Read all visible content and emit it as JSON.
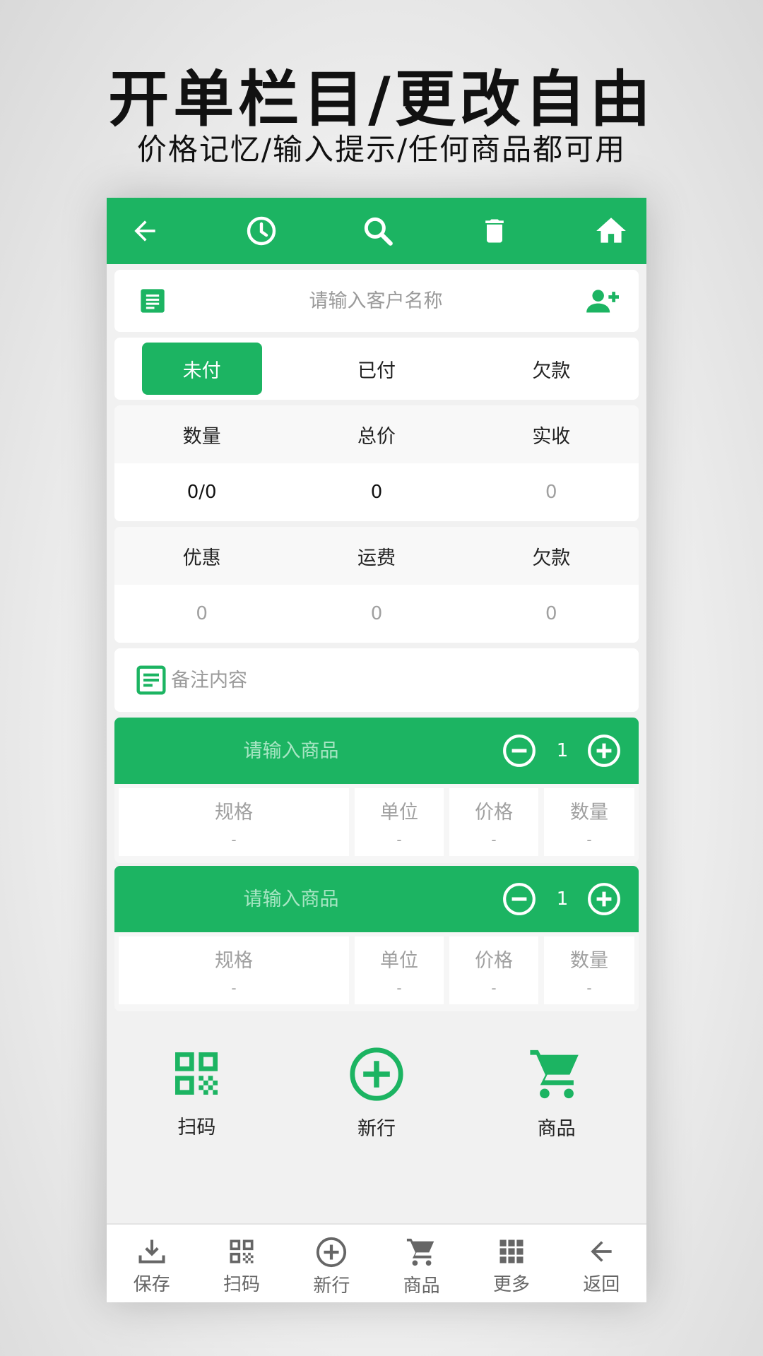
{
  "promo": {
    "title": "开单栏目/更改自由",
    "subtitle": "价格记忆/输入提示/任何商品都可用"
  },
  "topbar": {
    "icons": [
      "back-icon",
      "history-icon",
      "search-icon",
      "trash-icon",
      "home-icon"
    ]
  },
  "customer": {
    "placeholder": "请输入客户名称",
    "icons": [
      "document-icon",
      "add-user-icon"
    ]
  },
  "status_tabs": [
    {
      "label": "未付",
      "active": true
    },
    {
      "label": "已付",
      "active": false
    },
    {
      "label": "欠款",
      "active": false
    }
  ],
  "summary1": {
    "headers": [
      "数量",
      "总价",
      "实收"
    ],
    "values": [
      "0/0",
      "0",
      "0"
    ]
  },
  "summary2": {
    "headers": [
      "优惠",
      "运费",
      "欠款"
    ],
    "values": [
      "0",
      "0",
      "0"
    ]
  },
  "remark": {
    "placeholder": "备注内容"
  },
  "products": [
    {
      "placeholder": "请输入商品",
      "quantity": "1",
      "columns": [
        {
          "label": "规格",
          "value": "-"
        },
        {
          "label": "单位",
          "value": "-"
        },
        {
          "label": "价格",
          "value": "-"
        },
        {
          "label": "数量",
          "value": "-"
        }
      ]
    },
    {
      "placeholder": "请输入商品",
      "quantity": "1",
      "columns": [
        {
          "label": "规格",
          "value": "-"
        },
        {
          "label": "单位",
          "value": "-"
        },
        {
          "label": "价格",
          "value": "-"
        },
        {
          "label": "数量",
          "value": "-"
        }
      ]
    }
  ],
  "quick_actions": [
    {
      "label": "扫码",
      "icon": "qr-code-icon"
    },
    {
      "label": "新行",
      "icon": "add-circle-icon"
    },
    {
      "label": "商品",
      "icon": "cart-icon"
    }
  ],
  "bottom_nav": [
    {
      "label": "保存",
      "icon": "download-icon"
    },
    {
      "label": "扫码",
      "icon": "qr-code-icon"
    },
    {
      "label": "新行",
      "icon": "add-circle-icon"
    },
    {
      "label": "商品",
      "icon": "cart-icon"
    },
    {
      "label": "更多",
      "icon": "grid-icon"
    },
    {
      "label": "返回",
      "icon": "back-icon"
    }
  ],
  "colors": {
    "accent": "#1cb462",
    "background": "#f1f1f1",
    "nav_icon": "#666666"
  }
}
